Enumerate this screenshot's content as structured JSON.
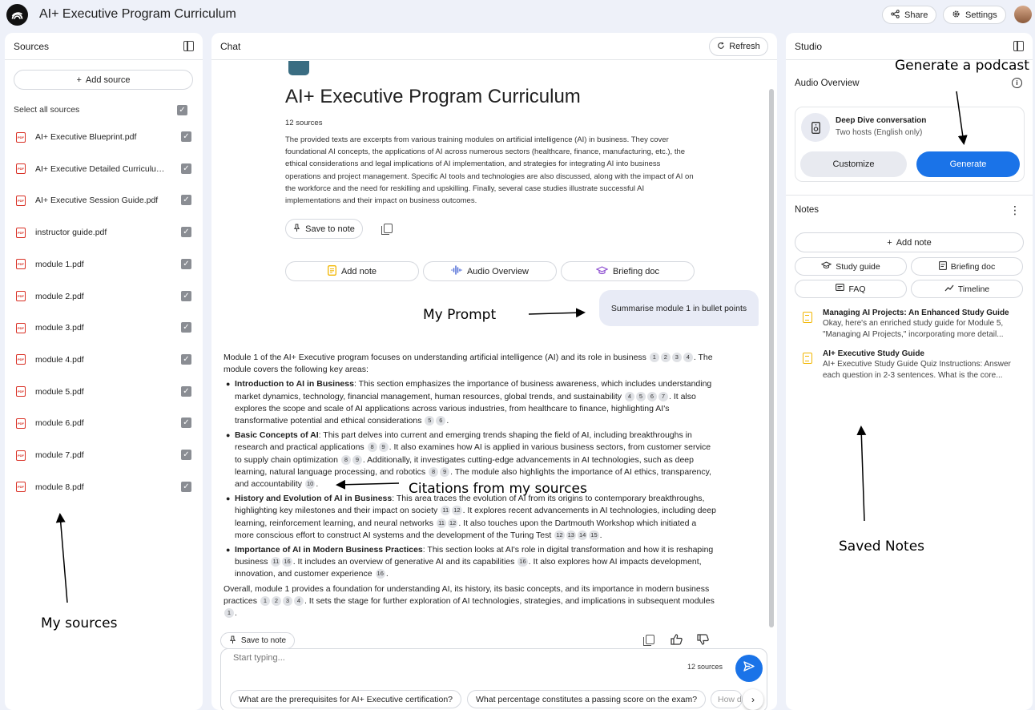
{
  "app": {
    "title": "AI+ Executive Program Curriculum",
    "share_label": "Share",
    "settings_label": "Settings"
  },
  "sources": {
    "header": "Sources",
    "add_label": "Add source",
    "select_all_label": "Select all sources",
    "items": [
      {
        "name": "AI+ Executive Blueprint.pdf"
      },
      {
        "name": "AI+ Executive Detailed Curriculum.pdf"
      },
      {
        "name": "AI+ Executive Session Guide.pdf"
      },
      {
        "name": "instructor guide.pdf"
      },
      {
        "name": "module 1.pdf"
      },
      {
        "name": "module 2.pdf"
      },
      {
        "name": "module 3.pdf"
      },
      {
        "name": "module 4.pdf"
      },
      {
        "name": "module 5.pdf"
      },
      {
        "name": "module 6.pdf"
      },
      {
        "name": "module 7.pdf"
      },
      {
        "name": "module 8.pdf"
      }
    ]
  },
  "chat": {
    "header": "Chat",
    "refresh_label": "Refresh",
    "notebook_title": "AI+ Executive Program Curriculum",
    "source_count": "12 sources",
    "summary": "The provided texts are excerpts from various training modules on artificial intelligence (AI) in business. They cover foundational AI concepts, the applications of AI across numerous sectors (healthcare, finance, manufacturing, etc.), the ethical considerations and legal implications of AI implementation, and strategies for integrating AI into business operations and project management. Specific AI tools and technologies are also discussed, along with the impact of AI on the workforce and the need for reskilling and upskilling. Finally, several case studies illustrate successful AI implementations and their impact on business outcomes.",
    "save_to_note_label": "Save to note",
    "suggestion_buttons": {
      "add_note": "Add note",
      "audio_overview": "Audio Overview",
      "briefing_doc": "Briefing doc"
    },
    "user_prompt": "Summarise module 1 in bullet points",
    "answer": {
      "intro_text": "Module 1 of the AI+ Executive program focuses on understanding artificial intelligence (AI) and its role in business",
      "intro_cites": [
        "1",
        "2",
        "3",
        "4"
      ],
      "intro_tail": ". The module covers the following key areas:",
      "b1_title": "Introduction to AI in Business",
      "b1_t1": ": This section emphasizes the importance of business awareness, which includes understanding market dynamics, technology, financial management, human resources, global trends, and sustainability",
      "b1_c1": [
        "4",
        "5",
        "6",
        "7"
      ],
      "b1_t2": ". It also explores the scope and scale of AI applications across various industries, from healthcare to finance, highlighting AI's transformative potential and ethical considerations",
      "b1_c2": [
        "5",
        "6"
      ],
      "b2_title": "Basic Concepts of AI",
      "b2_t1": ": This part delves into current and emerging trends shaping the field of AI, including breakthroughs in research and practical applications",
      "b2_c1": [
        "8",
        "9"
      ],
      "b2_t2": ". It also examines how AI is applied in various business sectors, from customer service to supply chain optimization",
      "b2_c2": [
        "8",
        "9"
      ],
      "b2_t3": ". Additionally, it investigates cutting-edge advancements in AI technologies, such as deep learning, natural language processing, and robotics",
      "b2_c3": [
        "8",
        "9"
      ],
      "b2_t4": ". The module also highlights the importance of AI ethics, transparency, and accountability",
      "b2_c4": [
        "10"
      ],
      "b3_title": "History and Evolution of AI in Business",
      "b3_t1": ": This area traces the evolution of AI from its origins to contemporary breakthroughs, highlighting key milestones and their impact on society",
      "b3_c1": [
        "11",
        "12"
      ],
      "b3_t2": ". It explores recent advancements in AI technologies, including deep learning, reinforcement learning, and neural networks",
      "b3_c2": [
        "11",
        "12"
      ],
      "b3_t3": ". It also touches upon the Dartmouth Workshop which initiated a more conscious effort to construct AI systems and the development of the Turing Test",
      "b3_c3": [
        "12",
        "13",
        "14",
        "15"
      ],
      "b4_title": "Importance of AI in Modern Business Practices",
      "b4_t1": ": This section looks at AI's role in digital transformation and how it is reshaping business",
      "b4_c1": [
        "11",
        "16"
      ],
      "b4_t2": ". It includes an overview of generative AI and its capabilities",
      "b4_c2": [
        "16"
      ],
      "b4_t3": ". It also explores how AI impacts development, innovation, and customer experience",
      "b4_c3": [
        "16"
      ],
      "outro_t1": "Overall, module 1 provides a foundation for understanding AI, its history, its basic concepts, and its importance in modern business practices",
      "outro_c1": [
        "1",
        "2",
        "3",
        "4"
      ],
      "outro_t2": ". It sets the stage for further exploration of AI technologies, strategies, and implications in subsequent modules",
      "outro_c2": [
        "1"
      ],
      "period": "."
    },
    "composer": {
      "placeholder": "Start typing...",
      "source_count": "12 sources",
      "suggestions": [
        "What are the prerequisites for AI+ Executive certification?",
        "What percentage constitutes a passing score on the exam?",
        "How d"
      ]
    }
  },
  "studio": {
    "header": "Studio",
    "audio_overview_label": "Audio Overview",
    "audio_card": {
      "title": "Deep Dive conversation",
      "subtitle": "Two hosts (English only)",
      "customize_label": "Customize",
      "generate_label": "Generate"
    },
    "notes_label": "Notes",
    "add_note_label": "Add note",
    "chips": [
      "Study guide",
      "Briefing doc",
      "FAQ",
      "Timeline"
    ],
    "notes": [
      {
        "title": "Managing AI Projects: An Enhanced Study Guide",
        "preview": "Okay, here's an enriched study guide for Module 5, \"Managing AI Projects,\" incorporating more detail..."
      },
      {
        "title": "AI+ Executive Study Guide",
        "preview": "AI+ Executive Study Guide Quiz Instructions: Answer each question in 2-3 sentences. What is the core..."
      }
    ]
  },
  "annotations": {
    "generate_podcast": "Generate a podcast",
    "my_prompt": "My Prompt",
    "citations": "Citations from my sources",
    "my_sources": "My sources",
    "saved_notes": "Saved Notes"
  },
  "colors": {
    "accent": "#1a73e8",
    "background": "#eef1f9",
    "pdf_red": "#d93025",
    "note_yellow": "#f2b600"
  },
  "icons": {
    "logo": "notebooklm-logo-icon",
    "share": "share-icon",
    "settings": "gear-icon",
    "panel_toggle": "panel-toggle-icon",
    "pdf": "pdf-icon",
    "check": "checkbox-checked-icon",
    "refresh": "refresh-icon",
    "pin": "pin-icon",
    "copy": "copy-icon",
    "thumbs_up": "thumbs-up-icon",
    "thumbs_down": "thumbs-down-icon",
    "send": "send-icon",
    "info": "info-icon",
    "kebab": "more-vert-icon"
  }
}
